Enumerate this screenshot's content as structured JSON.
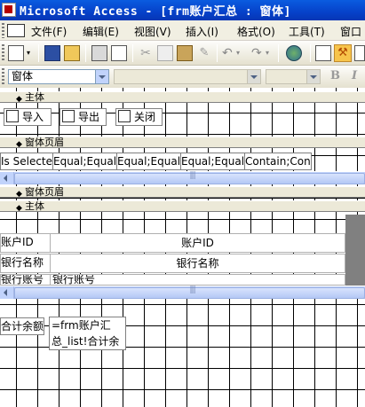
{
  "window": {
    "title": "Microsoft Access - [frm账户汇总 : 窗体]"
  },
  "menu": {
    "items": [
      "文件(F)",
      "编辑(E)",
      "视图(V)",
      "插入(I)",
      "格式(O)",
      "工具(T)",
      "窗口"
    ]
  },
  "toolbar2": {
    "object_combo_value": "窗体",
    "font_combo_value": "",
    "size_combo_value": "",
    "bold_label": "B",
    "italic_label": "I"
  },
  "sections": {
    "main_top": "主体",
    "form_header": "窗体页眉",
    "form_footer": "窗体页眉",
    "main_bottom": "主体"
  },
  "buttons": {
    "import": "导入",
    "export": "导出",
    "close": "关闭"
  },
  "header_fields": [
    "Is Selecte",
    "Equal;Equal",
    "Equal;Equal",
    "Equal;Equal",
    "Contain;Con"
  ],
  "table": {
    "rows": [
      {
        "label": "账户ID",
        "value": "账户ID"
      },
      {
        "label": "银行名称",
        "value": "银行名称"
      },
      {
        "label": "银行账号",
        "value": "银行账号"
      }
    ]
  },
  "footer": {
    "total_label": "合计余额",
    "total_expr_line1": "=frm账户汇",
    "total_expr_line2": "总_list!合计余"
  }
}
